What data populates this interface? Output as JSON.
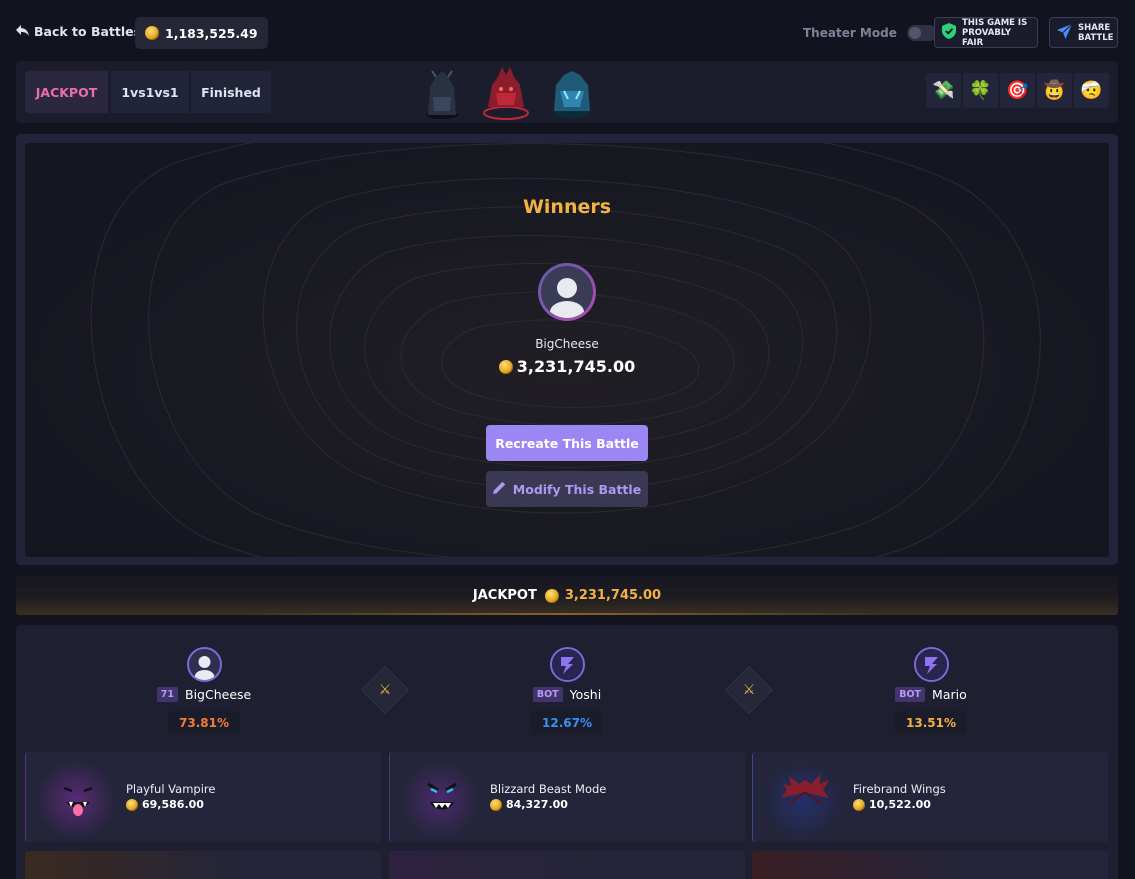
{
  "header": {
    "back_label": "Back to Battles",
    "balance": "1,183,525.49",
    "theater_label": "Theater Mode",
    "fair_label_1": "THIS GAME IS",
    "fair_label_2": "PROVABLY FAIR",
    "share_label_1": "SHARE",
    "share_label_2": "BATTLE"
  },
  "tabs": [
    {
      "label": "JACKPOT",
      "active": true
    },
    {
      "label": "1vs1vs1",
      "active": false
    },
    {
      "label": "Finished",
      "active": false
    }
  ],
  "emojis": [
    "💸",
    "🍀",
    "🎯",
    "🤠",
    "🤕"
  ],
  "winners": {
    "title": "Winners",
    "name": "BigCheese",
    "amount": "3,231,745.00",
    "recreate_label": "Recreate This Battle",
    "modify_label": "Modify This Battle"
  },
  "jackpot": {
    "label": "JACKPOT",
    "amount": "3,231,745.00"
  },
  "players": [
    {
      "badge": "71",
      "name": "BigCheese",
      "percent": "73.81%",
      "color": "#f47b3b"
    },
    {
      "badge": "BOT",
      "name": "Yoshi",
      "percent": "12.67%",
      "color": "#3b8ff4"
    },
    {
      "badge": "BOT",
      "name": "Mario",
      "percent": "13.51%",
      "color": "#f2b344"
    }
  ],
  "items": [
    {
      "name": "Playful Vampire",
      "value": "69,586.00",
      "color": "#a23fc7"
    },
    {
      "name": "Blizzard Beast Mode",
      "value": "84,327.00",
      "color": "#a23fc7"
    },
    {
      "name": "Firebrand Wings",
      "value": "10,522.00",
      "color": "#3f59c7"
    }
  ]
}
